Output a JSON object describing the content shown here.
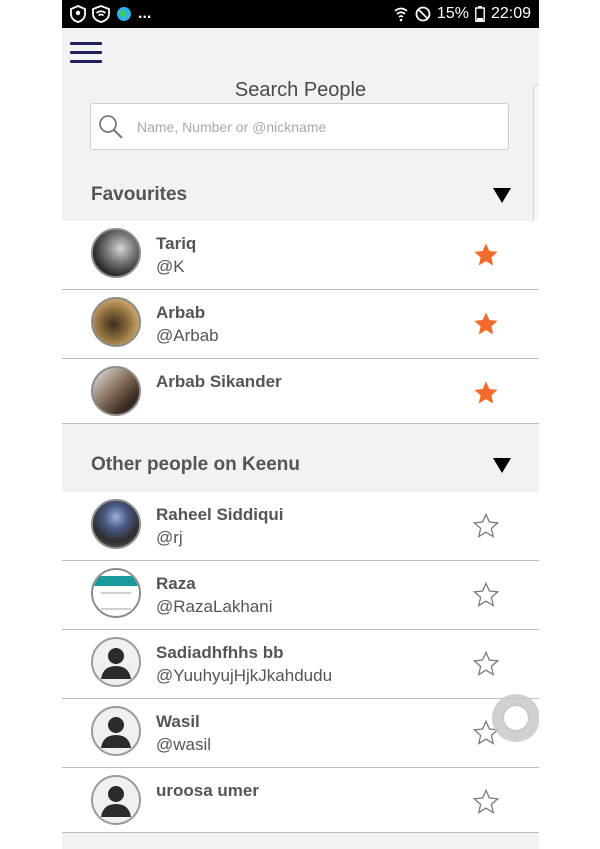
{
  "status_bar": {
    "icons_left": [
      "shield-icon",
      "wifi-shield-icon",
      "globe-icon"
    ],
    "overflow": "...",
    "battery": "15%",
    "time": "22:09"
  },
  "header": {
    "menu_icon": "hamburger-icon",
    "title": "Search People"
  },
  "search": {
    "placeholder": "Name, Number or @nickname",
    "icon": "search-icon"
  },
  "sections": {
    "favourites": {
      "title": "Favourites",
      "people": [
        {
          "name": "Tariq",
          "nickname": "@K",
          "avatar": "photo",
          "starred": true
        },
        {
          "name": "Arbab",
          "nickname": "@Arbab",
          "avatar": "photo",
          "starred": true
        },
        {
          "name": "Arbab Sikander",
          "nickname": "",
          "avatar": "photo",
          "starred": true
        }
      ]
    },
    "others": {
      "title": "Other people on Keenu",
      "people": [
        {
          "name": "Raheel Siddiqui",
          "nickname": "@rj",
          "avatar": "photo",
          "starred": false
        },
        {
          "name": "Raza",
          "nickname": "@RazaLakhani",
          "avatar": "photo",
          "starred": false
        },
        {
          "name": "Sadiadhfhhs bb",
          "nickname": "@YuuhyujHjkJkahdudu",
          "avatar": "default",
          "starred": false
        },
        {
          "name": "Wasil",
          "nickname": "@wasil",
          "avatar": "default",
          "starred": false
        },
        {
          "name": "uroosa umer",
          "nickname": "",
          "avatar": "default",
          "starred": false
        }
      ]
    }
  },
  "colors": {
    "accent_star": "#f26b2a",
    "menu_icon": "#1f1f5a",
    "status_bar_bg": "#000000"
  }
}
